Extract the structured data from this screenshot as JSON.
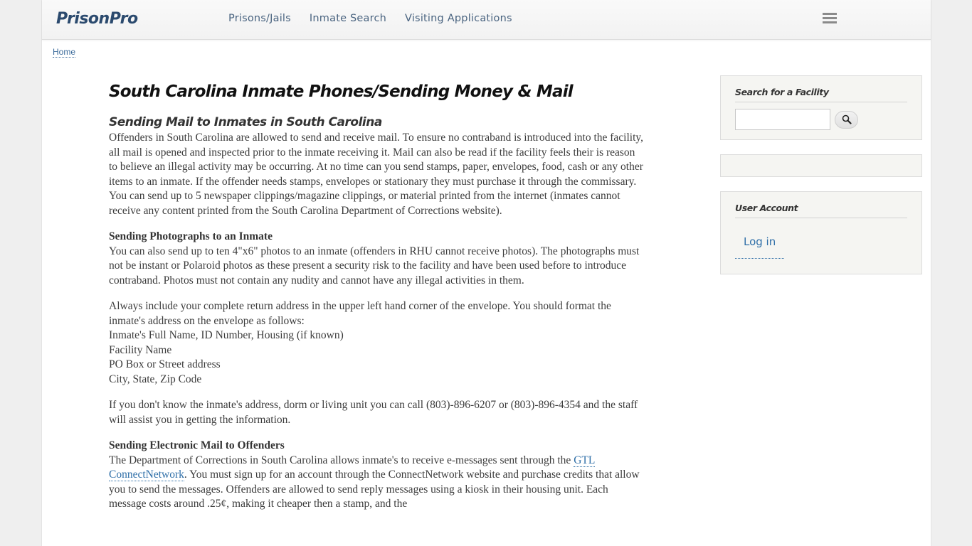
{
  "header": {
    "logo": "PrisonPro",
    "nav": [
      {
        "label": "Prisons/Jails"
      },
      {
        "label": "Inmate Search"
      },
      {
        "label": "Visiting Applications"
      }
    ],
    "menu_icon": "hamburger-menu-icon"
  },
  "breadcrumb": {
    "items": [
      {
        "label": "Home"
      }
    ]
  },
  "main": {
    "title": "South Carolina Inmate Phones/Sending Money & Mail",
    "section_title": "Sending Mail to Inmates in South Carolina",
    "p1": "Offenders in South Carolina are allowed to send and receive mail.  To ensure no contraband is introduced into the facility, all mail is opened and inspected prior to the inmate receiving it.  Mail can also be read if the facility feels their is reason to believe an illegal activity may be occurring.  At no time can you send stamps, paper, envelopes, food, cash or any other items to an inmate.  If the offender needs stamps, envelopes or stationary they must purchase it through the commissary.  You can send up to 5 newspaper clippings/magazine clippings, or material printed from the internet (inmates cannot receive any content printed from the South Carolina Department of Corrections website).",
    "photos_heading": "Sending Photographs to an Inmate",
    "photos_text": "You can also send up to ten 4\"x6\" photos to an inmate (offenders in RHU cannot receive photos).  The photographs must not be instant or Polaroid photos as these present a security risk to the facility and have been used before to introduce contraband.  Photos must not contain any nudity and cannot have any illegal activities in them.",
    "address_intro": "Always include your complete return address in the upper left hand corner of the envelope.  You should format the inmate's address on the envelope as follows:",
    "address_lines": [
      "Inmate's Full Name, ID Number, Housing (if known)",
      "Facility Name",
      "PO Box or Street address",
      "City, State, Zip Code"
    ],
    "phone_text": "If you don't know the inmate's address, dorm or living unit you can call (803)-896-6207 or (803)-896-4354 and the staff will assist you in getting the information.",
    "email_heading": "Sending Electronic Mail to Offenders",
    "email_text_before": "The Department of Corrections in South Carolina allows inmate's to receive e-messages sent through the ",
    "email_link": "GTL ConnectNetwork",
    "email_text_after": ".  You must sign up for an account through the ConnectNetwork website and purchase credits that allow you to send the messages.  Offenders are allowed to send reply messages using a kiosk in their housing unit.  Each message costs around .25¢, making it cheaper then a stamp, and the"
  },
  "sidebar": {
    "search_block": {
      "title": "Search for a Facility",
      "input_value": "",
      "input_placeholder": "",
      "button_icon": "search-icon"
    },
    "account_block": {
      "title": "User Account",
      "login_label": "Log in"
    }
  }
}
